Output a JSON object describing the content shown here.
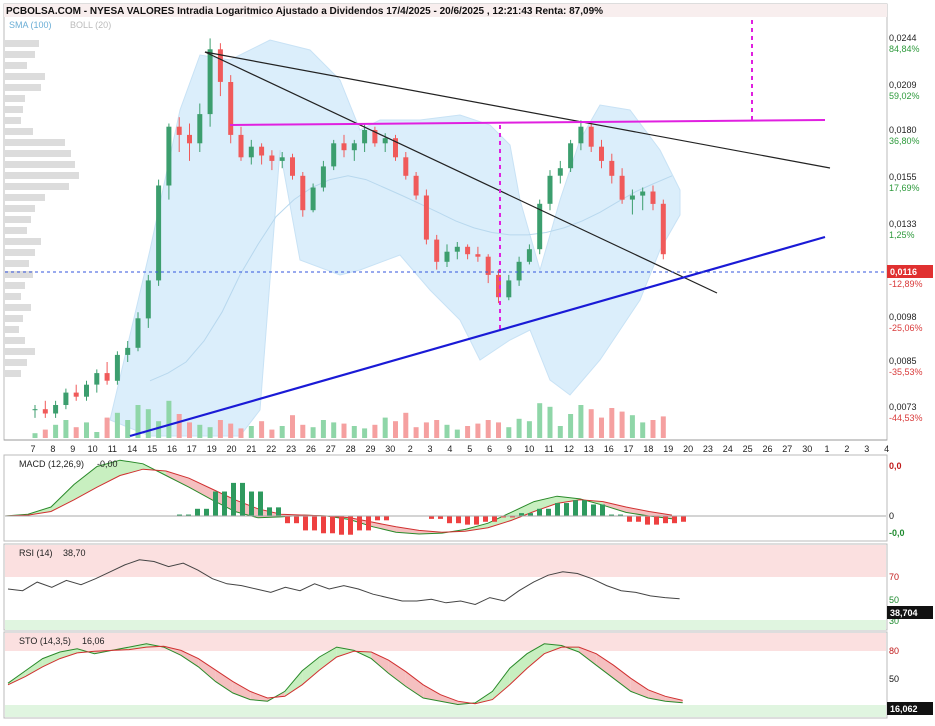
{
  "header": {
    "title": "PCBOLSA.COM - NYESA VALORES Intradia Logaritmico Ajustado a Dividendos 17/4/2025 - 20/6/2025 , 12:21:43 Renta: 87,09%",
    "sma_label": "SMA (100)",
    "boll_label": "BOLL (20)"
  },
  "colors": {
    "up": "#3c9e6e",
    "down": "#f05a5a",
    "boll_fill": "#dbeefb",
    "trend_black": "#222222",
    "trend_blue": "#1a1ad6",
    "magenta": "#e020e0",
    "current_price_box": "#e03030"
  },
  "price_axis": {
    "ticks": [
      {
        "price": "0,0244",
        "pct": "84,84%"
      },
      {
        "price": "0,0209",
        "pct": "59,02%"
      },
      {
        "price": "0,0180",
        "pct": "36,80%"
      },
      {
        "price": "0,0155",
        "pct": "17,69%"
      },
      {
        "price": "0,0133",
        "pct": "1,25%"
      },
      {
        "price": "0,0098",
        "pct": "-25,06%"
      },
      {
        "price": "0,0085",
        "pct": "-35,53%"
      },
      {
        "price": "0,0073",
        "pct": "-44,53%"
      }
    ],
    "current_price": "0,0116",
    "current_pct": "-12,89%"
  },
  "x_axis_labels": [
    "7",
    "8",
    "9",
    "10",
    "11",
    "14",
    "15",
    "16",
    "17",
    "19",
    "20",
    "21",
    "22",
    "23",
    "26",
    "27",
    "28",
    "29",
    "30",
    "2",
    "3",
    "4",
    "5",
    "6",
    "9",
    "10",
    "11",
    "12",
    "13",
    "16",
    "17",
    "18",
    "19",
    "20",
    "23",
    "24",
    "25",
    "26",
    "27",
    "30",
    "1",
    "2",
    "3",
    "4"
  ],
  "panels": {
    "macd": {
      "label": "MACD (12,26,9)",
      "value": "-0,00",
      "ticks": [
        "0,0",
        "0",
        "-0,0"
      ]
    },
    "rsi": {
      "label": "RSI (14)",
      "value": "38,70",
      "ticks": [
        "70",
        "50",
        "30"
      ],
      "current": "38,704"
    },
    "sto": {
      "label": "STO (14,3,5)",
      "value": "16,06",
      "ticks": [
        "80",
        "50"
      ],
      "current": "16,062"
    }
  },
  "chart_data": {
    "type": "candlestick",
    "scale": "log",
    "ohlc": [
      [
        0.0068,
        0.0069,
        0.0066,
        0.0068
      ],
      [
        0.0068,
        0.007,
        0.0066,
        0.0067
      ],
      [
        0.0067,
        0.007,
        0.0066,
        0.0069
      ],
      [
        0.0069,
        0.0073,
        0.0068,
        0.0072
      ],
      [
        0.0072,
        0.0074,
        0.007,
        0.0071
      ],
      [
        0.0071,
        0.0075,
        0.007,
        0.0074
      ],
      [
        0.0074,
        0.0078,
        0.0072,
        0.0077
      ],
      [
        0.0077,
        0.008,
        0.0074,
        0.0075
      ],
      [
        0.0075,
        0.0083,
        0.0074,
        0.0082
      ],
      [
        0.0082,
        0.0086,
        0.008,
        0.0084
      ],
      [
        0.0084,
        0.0095,
        0.0083,
        0.0093
      ],
      [
        0.0093,
        0.0108,
        0.009,
        0.0106
      ],
      [
        0.0106,
        0.015,
        0.0104,
        0.0147
      ],
      [
        0.0147,
        0.0182,
        0.014,
        0.018
      ],
      [
        0.018,
        0.0186,
        0.0165,
        0.0175
      ],
      [
        0.0175,
        0.0182,
        0.016,
        0.017
      ],
      [
        0.017,
        0.0195,
        0.0165,
        0.0188
      ],
      [
        0.0188,
        0.0244,
        0.018,
        0.0235
      ],
      [
        0.0235,
        0.024,
        0.02,
        0.021
      ],
      [
        0.021,
        0.0215,
        0.017,
        0.0175
      ],
      [
        0.0175,
        0.018,
        0.016,
        0.0162
      ],
      [
        0.0162,
        0.0172,
        0.0158,
        0.0168
      ],
      [
        0.0168,
        0.017,
        0.0158,
        0.0163
      ],
      [
        0.0163,
        0.0166,
        0.0155,
        0.016
      ],
      [
        0.016,
        0.0165,
        0.0156,
        0.0162
      ],
      [
        0.0162,
        0.0164,
        0.015,
        0.0152
      ],
      [
        0.0152,
        0.0154,
        0.0132,
        0.0135
      ],
      [
        0.0135,
        0.0148,
        0.0134,
        0.0146
      ],
      [
        0.0146,
        0.016,
        0.0144,
        0.0157
      ],
      [
        0.0157,
        0.0172,
        0.0155,
        0.017
      ],
      [
        0.017,
        0.0175,
        0.0162,
        0.0166
      ],
      [
        0.0166,
        0.0172,
        0.016,
        0.017
      ],
      [
        0.017,
        0.0182,
        0.0165,
        0.0178
      ],
      [
        0.0178,
        0.018,
        0.0168,
        0.017
      ],
      [
        0.017,
        0.0176,
        0.0165,
        0.0173
      ],
      [
        0.0173,
        0.0175,
        0.016,
        0.0162
      ],
      [
        0.0162,
        0.0165,
        0.015,
        0.0152
      ],
      [
        0.0152,
        0.0154,
        0.014,
        0.0142
      ],
      [
        0.0142,
        0.0145,
        0.012,
        0.0122
      ],
      [
        0.0122,
        0.0124,
        0.011,
        0.0113
      ],
      [
        0.0113,
        0.012,
        0.0111,
        0.0117
      ],
      [
        0.0117,
        0.0121,
        0.0114,
        0.0119
      ],
      [
        0.0119,
        0.012,
        0.0114,
        0.0116
      ],
      [
        0.0116,
        0.0119,
        0.0113,
        0.0115
      ],
      [
        0.0115,
        0.0116,
        0.0105,
        0.0108
      ],
      [
        0.0108,
        0.011,
        0.0098,
        0.01
      ],
      [
        0.01,
        0.0108,
        0.0099,
        0.0106
      ],
      [
        0.0106,
        0.0115,
        0.0104,
        0.0113
      ],
      [
        0.0113,
        0.012,
        0.0112,
        0.0118
      ],
      [
        0.0118,
        0.014,
        0.0116,
        0.0138
      ],
      [
        0.0138,
        0.0155,
        0.0135,
        0.0152
      ],
      [
        0.0152,
        0.016,
        0.0148,
        0.0156
      ],
      [
        0.0156,
        0.0172,
        0.0154,
        0.017
      ],
      [
        0.017,
        0.0184,
        0.0166,
        0.018
      ],
      [
        0.018,
        0.0182,
        0.0165,
        0.0168
      ],
      [
        0.0168,
        0.0172,
        0.0156,
        0.016
      ],
      [
        0.016,
        0.0164,
        0.0148,
        0.0152
      ],
      [
        0.0152,
        0.0156,
        0.0138,
        0.014
      ],
      [
        0.014,
        0.0145,
        0.0133,
        0.0142
      ],
      [
        0.0142,
        0.0146,
        0.0135,
        0.0144
      ],
      [
        0.0144,
        0.0147,
        0.0135,
        0.0138
      ],
      [
        0.0138,
        0.014,
        0.0114,
        0.0116
      ]
    ],
    "volumes": [
      8,
      14,
      22,
      30,
      18,
      26,
      10,
      34,
      42,
      30,
      55,
      48,
      28,
      62,
      40,
      26,
      22,
      18,
      30,
      24,
      16,
      20,
      28,
      14,
      20,
      38,
      22,
      18,
      30,
      26,
      24,
      20,
      16,
      22,
      34,
      28,
      42,
      18,
      26,
      30,
      22,
      14,
      20,
      24,
      30,
      26,
      18,
      32,
      28,
      58,
      52,
      20,
      40,
      55,
      48,
      34,
      50,
      44,
      38,
      26,
      30,
      36
    ],
    "sma100": [
      0.0075,
      0.0077,
      0.008,
      0.0086,
      0.0095,
      0.0108,
      0.012,
      0.0132,
      0.014,
      0.0146,
      0.015,
      0.0152,
      0.015,
      0.0146,
      0.0142,
      0.0138,
      0.0134,
      0.013,
      0.0127,
      0.0125,
      0.0124,
      0.0124,
      0.0125,
      0.0127,
      0.013,
      0.0134,
      0.0139,
      0.0144,
      0.0148,
      0.0152
    ],
    "macd_line": [
      0.0,
      0.0002,
      0.001,
      0.0035,
      0.0055,
      0.0062,
      0.0058,
      0.0045,
      0.0032,
      0.0018,
      0.0005,
      -0.0002,
      -0.0001,
      0.0001,
      0.0,
      -0.0004,
      -0.0012,
      -0.0018,
      -0.002,
      -0.0019,
      -0.0015,
      -0.0008,
      0.0004,
      0.0016,
      0.0022,
      0.0019,
      0.0012,
      0.0004,
      0.0,
      -0.0003
    ],
    "macd_signal": [
      0.0,
      0.0001,
      0.0005,
      0.0018,
      0.0032,
      0.0045,
      0.0052,
      0.005,
      0.0042,
      0.003,
      0.0018,
      0.0008,
      0.0002,
      0.0001,
      0.0,
      -0.0002,
      -0.0007,
      -0.0012,
      -0.0016,
      -0.0018,
      -0.0017,
      -0.0013,
      -0.0005,
      0.0005,
      0.0014,
      0.0018,
      0.0016,
      0.001,
      0.0005,
      0.0001
    ],
    "rsi": [
      50,
      48,
      58,
      52,
      60,
      55,
      62,
      70,
      78,
      84,
      82,
      76,
      80,
      72,
      62,
      56,
      54,
      50,
      46,
      52,
      48,
      56,
      50,
      54,
      50,
      44,
      40,
      36,
      36,
      38,
      34,
      36,
      32,
      40,
      36,
      48,
      58,
      66,
      70,
      68,
      62,
      54,
      48,
      46,
      42,
      40,
      38.7
    ],
    "sto_k": [
      40,
      55,
      70,
      78,
      82,
      76,
      80,
      84,
      88,
      84,
      74,
      60,
      42,
      28,
      20,
      18,
      30,
      55,
      72,
      84,
      80,
      70,
      52,
      36,
      22,
      18,
      14,
      16,
      30,
      58,
      76,
      88,
      86,
      78,
      62,
      46,
      30,
      22,
      18,
      16.06
    ],
    "sto_d": [
      38,
      48,
      60,
      70,
      77,
      79,
      80,
      81,
      84,
      85,
      80,
      70,
      56,
      42,
      30,
      22,
      24,
      38,
      56,
      72,
      79,
      78,
      68,
      54,
      38,
      26,
      18,
      15,
      20,
      38,
      58,
      76,
      84,
      84,
      76,
      62,
      46,
      32,
      24,
      19
    ]
  }
}
